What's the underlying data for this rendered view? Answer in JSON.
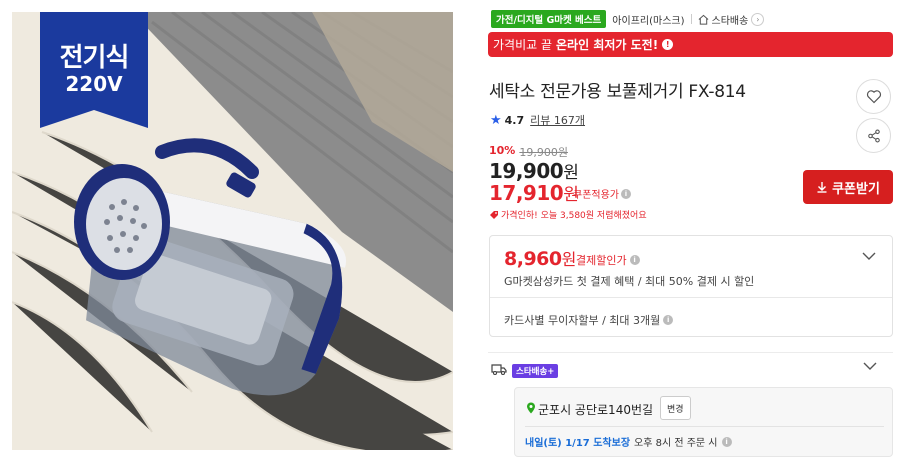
{
  "image": {
    "ribbon_line1": "전기식",
    "ribbon_line2": "220V"
  },
  "badges": {
    "best": "가전/디지털 G마켓 베스트",
    "seller": "아이프리(마스크)",
    "star_delivery": "스타배송"
  },
  "promo": {
    "prefix": "가격비교 끝",
    "highlight": "온라인 최저가 도전!"
  },
  "product": {
    "title": "세탁소 전문가용 보풀제거기 FX-814",
    "rating": "4.7",
    "review_label": "리뷰 167개"
  },
  "price": {
    "discount_rate": "10%",
    "original": "19,900원",
    "sale_number": "19,900",
    "coupon_number": "17,910",
    "won": "원",
    "coupon_label": "쿠폰적용가",
    "coupon_button": "쿠폰받기",
    "price_drop": "가격인하! 오늘 3,580원 저렴해졌어요"
  },
  "card": {
    "price_number": "8,960",
    "won": "원",
    "label": "결제할인가",
    "desc": "G마켓삼성카드 첫 결제 혜택 / 최대 50% 결제 시 할인",
    "installment": "카드사별 무이자할부 / 최대 3개월"
  },
  "shipping": {
    "badge": "스타배송+",
    "address": "군포시 공단로140번길",
    "change_button": "변경",
    "delivery_date": "내일(토) 1/17 도착보장",
    "delivery_condition": "오후 8시 전 주문 시"
  },
  "colors": {
    "accent_red": "#e4252e",
    "coupon_button": "#d61f1f",
    "best_green": "#2aa81e",
    "rating_blue": "#2a5fe8",
    "ribbon_navy": "#1b3a9e",
    "star_purple": "#6a3ee3"
  },
  "icons": {
    "wishlist": "heart-icon",
    "share": "share-icon",
    "download": "download-icon",
    "truck": "truck-icon",
    "pin": "location-pin-icon"
  }
}
